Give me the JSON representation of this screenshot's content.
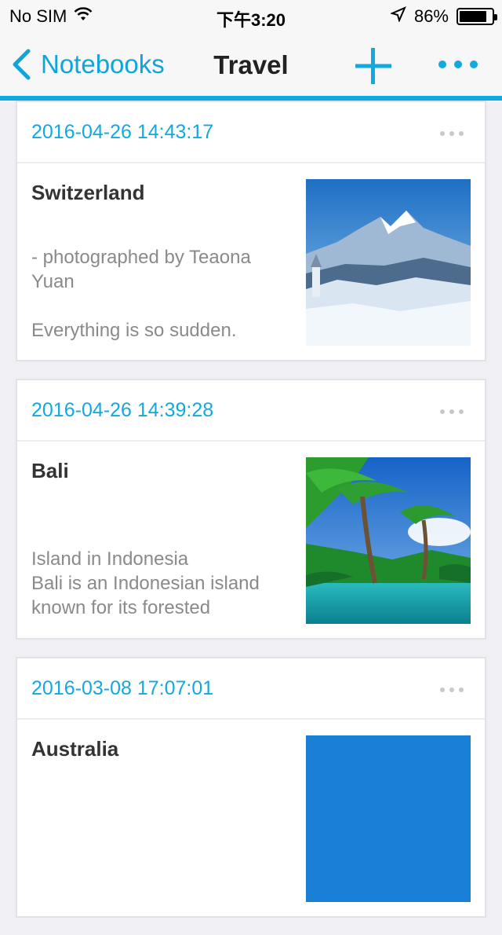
{
  "status_bar": {
    "carrier": "No SIM",
    "time": "下午3:20",
    "battery_percent": "86%",
    "battery_level": 0.86
  },
  "nav": {
    "back_label": "Notebooks",
    "title": "Travel",
    "accent_color": "#12a9e0"
  },
  "notes": [
    {
      "date": "2016-04-26 14:43:17",
      "title": "Switzerland",
      "lines": [
        "- photographed by Teaona",
        "Yuan",
        "",
        "Everything is so sudden."
      ],
      "image": "swiss-alps-photo"
    },
    {
      "date": "2016-04-26 14:39:28",
      "title": "Bali",
      "lines": [
        "Island in Indonesia",
        "Bali is an Indonesian island",
        "known for its forested"
      ],
      "image": "tropical-beach-photo"
    },
    {
      "date": "2016-03-08 17:07:01",
      "title": "Australia",
      "lines": [],
      "image": "sky-photo"
    }
  ]
}
